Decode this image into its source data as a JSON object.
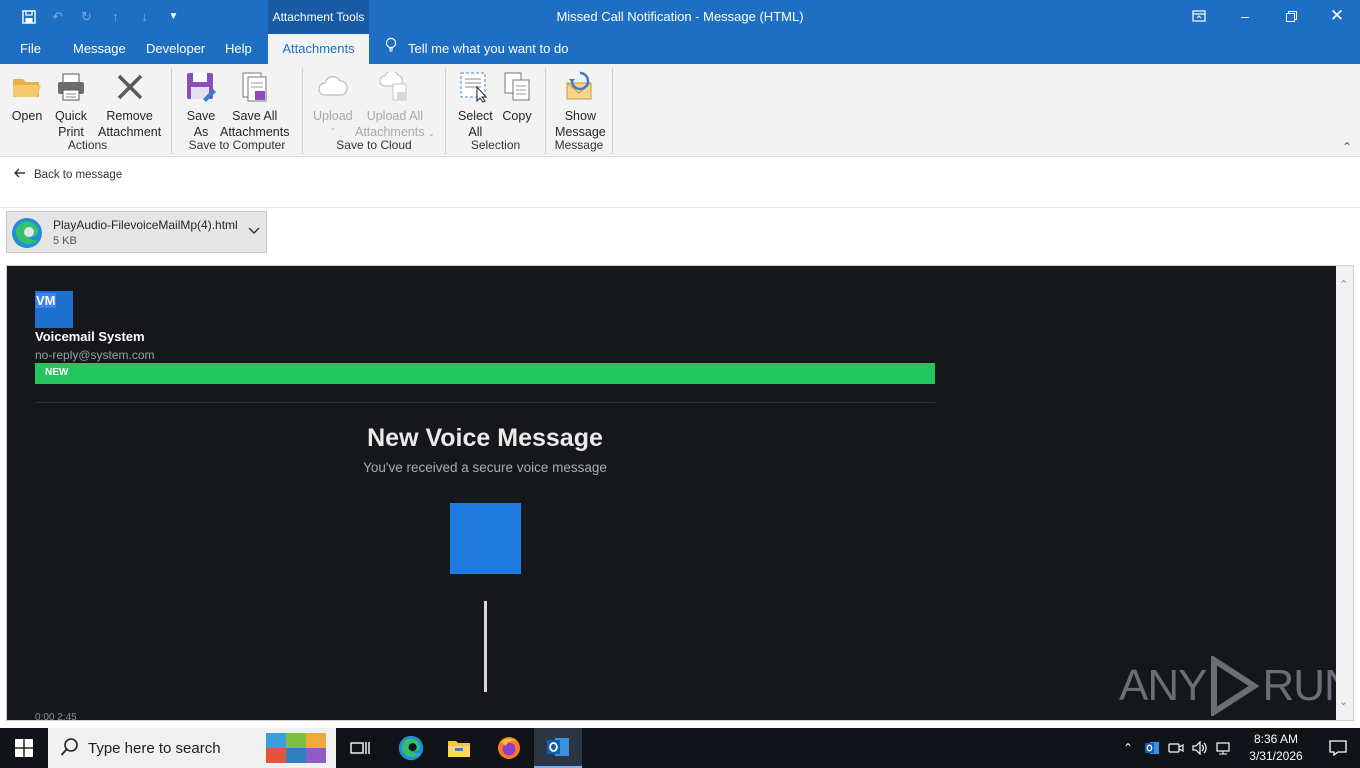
{
  "window": {
    "title": "Missed Call Notification  -  Message (HTML)",
    "context_tab_group": "Attachment Tools"
  },
  "quick_access": {
    "icons": [
      "save-icon",
      "undo-icon",
      "redo-icon",
      "up-icon",
      "down-icon",
      "customize-icon"
    ]
  },
  "tabs": [
    {
      "label": "File"
    },
    {
      "label": "Message"
    },
    {
      "label": "Developer"
    },
    {
      "label": "Help"
    },
    {
      "label": "Attachments"
    }
  ],
  "tell_me": "Tell me what you want to do",
  "ribbon": {
    "groups": {
      "actions": "Actions",
      "save_to_computer": "Save to Computer",
      "save_to_cloud": "Save to Cloud",
      "selection": "Selection",
      "message": "Message"
    },
    "buttons": {
      "open": "Open",
      "quick_print_1": "Quick",
      "quick_print_2": "Print",
      "remove_1": "Remove",
      "remove_2": "Attachment",
      "save_as_1": "Save",
      "save_as_2": "As",
      "save_all_1": "Save All",
      "save_all_2": "Attachments",
      "upload": "Upload",
      "upload_all_1": "Upload All",
      "upload_all_2": "Attachments",
      "select_all_1": "Select",
      "select_all_2": "All",
      "copy": "Copy",
      "show_message_1": "Show",
      "show_message_2": "Message"
    }
  },
  "back_link": "Back to message",
  "attachment": {
    "name": "PlayAudio-FilevoiceMailMp(4).html",
    "size": "5 KB"
  },
  "preview": {
    "badge": "VM",
    "sender_name": "Voicemail System",
    "sender_email": "no-reply@system.com",
    "status_tag": "NEW",
    "heading": "New Voice Message",
    "subheading": "You've received a secure voice message",
    "duration": "0:00 2:45",
    "watermark": "ANY RUN",
    "colors": {
      "background": "#15171b",
      "badge": "#1f6fd1",
      "status_bar": "#22c55e",
      "player_square": "#1f7ae0"
    }
  },
  "taskbar": {
    "search_placeholder": "Type here to search",
    "time": "8:36 AM",
    "date": "3/31/2026",
    "pinned_icons": [
      "task-view-icon",
      "edge-icon",
      "file-explorer-icon",
      "firefox-icon",
      "outlook-icon"
    ]
  }
}
